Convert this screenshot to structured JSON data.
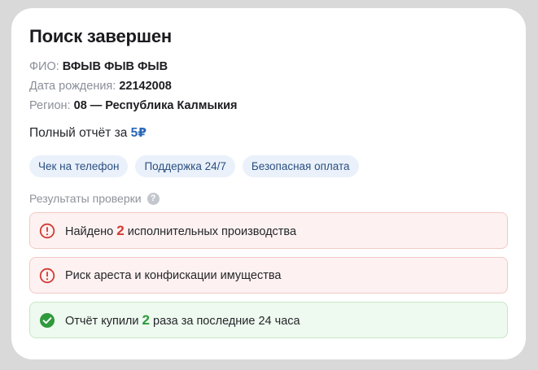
{
  "header": {
    "title": "Поиск завершен"
  },
  "info": {
    "fio_label": "ФИО: ",
    "fio_value": "ВФЫВ ФЫВ ФЫВ",
    "dob_label": "Дата рождения: ",
    "dob_value": "22142008",
    "region_label": "Регион: ",
    "region_value": "08 — Республика Калмыкия"
  },
  "price": {
    "label": "Полный отчёт за ",
    "amount": "5₽"
  },
  "chips": [
    "Чек на телефон",
    "Поддержка 24/7",
    "Безопасная оплата"
  ],
  "results": {
    "title": "Результаты проверки",
    "help_icon": "question-icon",
    "items": [
      {
        "type": "warning",
        "icon": "exclamation-icon",
        "before": "Найдено ",
        "num": "2",
        "after": " исполнительных производства"
      },
      {
        "type": "warning",
        "icon": "exclamation-icon",
        "before": "Риск ареста и конфискации имущества",
        "num": "",
        "after": ""
      },
      {
        "type": "success",
        "icon": "check-icon",
        "before": "Отчёт купили ",
        "num": "2",
        "after": " раза за последние 24 часа"
      }
    ]
  },
  "colors": {
    "accent": "#2a67b8",
    "warning": "#d23a32",
    "success": "#2e9a3c",
    "chip_bg": "#eaf1fa"
  }
}
